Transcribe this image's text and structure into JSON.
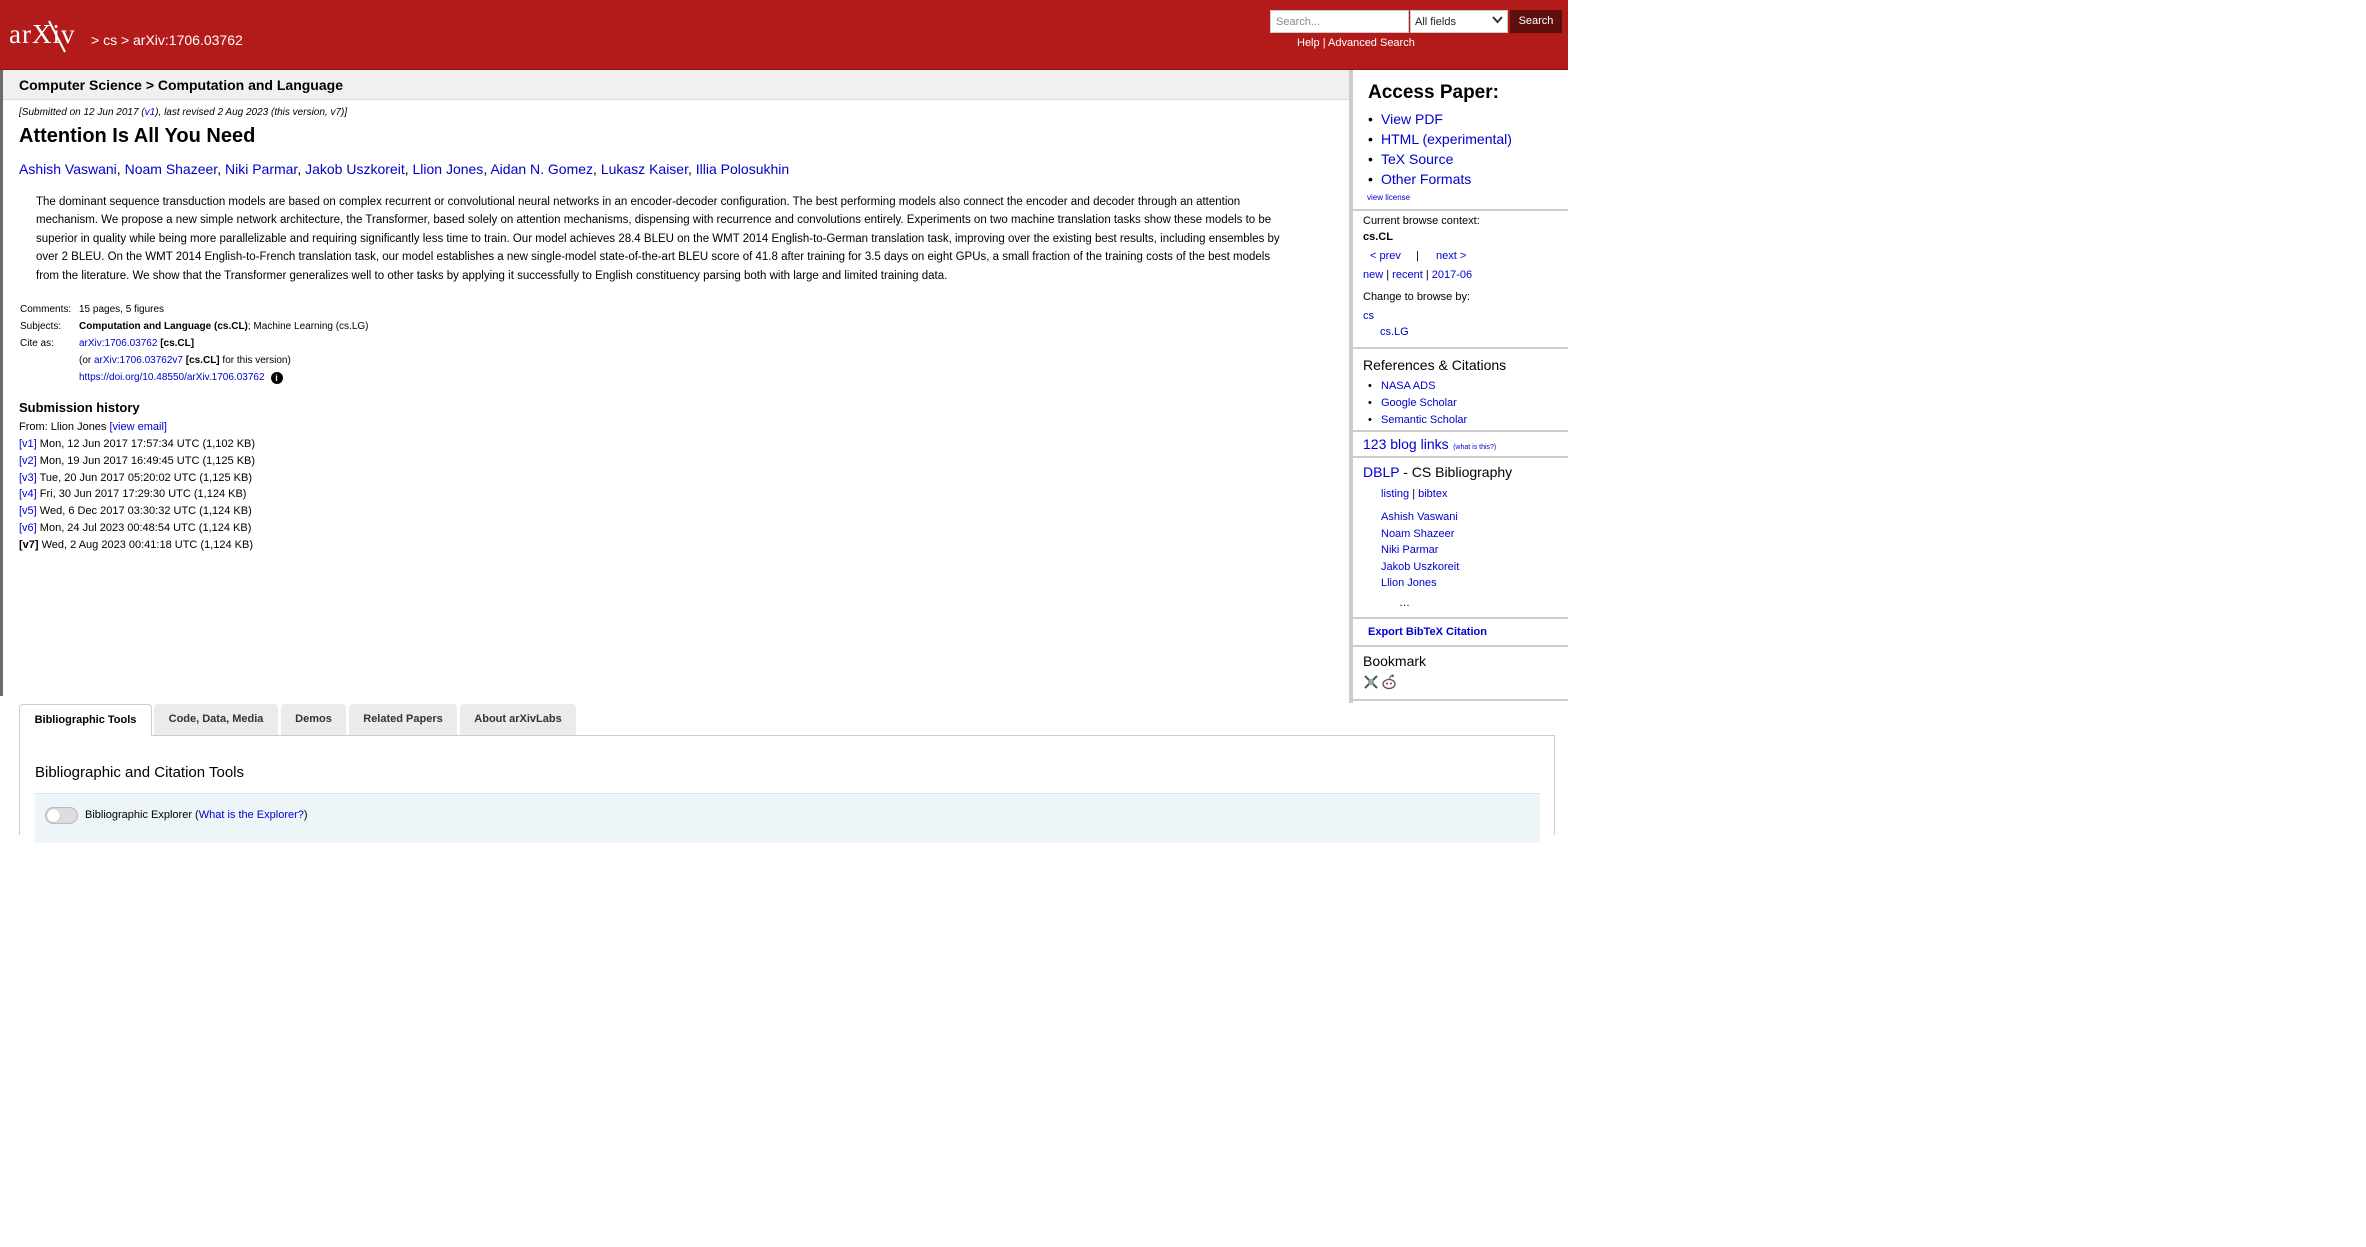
{
  "header": {
    "logo_text": "arXiv",
    "breadcrumb": "> cs > arXiv:1706.03762",
    "search": {
      "placeholder": "Search...",
      "field_value": "All fields",
      "button": "Search"
    },
    "help": "Help",
    "help_sep": "|",
    "advanced": "Advanced Search"
  },
  "catbar": "Computer Science > Computation and Language",
  "paper": {
    "dateline_pre": "[Submitted on 12 Jun 2017 (",
    "dateline_v1": "v1",
    "dateline_post": "), last revised 2 Aug 2023 (this version, v7)]",
    "title": "Attention Is All You Need",
    "authors": [
      "Ashish Vaswani",
      "Noam Shazeer",
      "Niki Parmar",
      "Jakob Uszkoreit",
      "Llion Jones",
      "Aidan N. Gomez",
      "Lukasz Kaiser",
      "Illia Polosukhin"
    ],
    "abstract_lines": [
      "The dominant sequence transduction models are based on complex recurrent or convolutional neural networks in an encoder-decoder configuration. The best performing models also connect the encoder and decoder through an attention",
      "mechanism. We propose a new simple network architecture, the Transformer, based solely on attention mechanisms, dispensing with recurrence and convolutions entirely. Experiments on two machine translation tasks show these models to be",
      "superior in quality while being more parallelizable and requiring significantly less time to train. Our model achieves 28.4 BLEU on the WMT 2014 English-to-German translation task, improving over the existing best results, including ensembles by",
      "over 2 BLEU. On the WMT 2014 English-to-French translation task, our model establishes a new single-model state-of-the-art BLEU score of 41.8 after training for 3.5 days on eight GPUs, a small fraction of the training costs of the best models",
      "from the literature. We show that the Transformer generalizes well to other tasks by applying it successfully to English constituency parsing both with large and limited training data."
    ]
  },
  "meta": {
    "comments_label": "Comments:",
    "comments": "15 pages, 5 figures",
    "subjects_label": "Subjects:",
    "subjects_primary": "Computation and Language (cs.CL)",
    "subjects_rest": "; Machine Learning (cs.LG)",
    "cite_label": "Cite as:",
    "cite_id": "arXiv:1706.03762",
    "cite_cat": "[cs.CL]",
    "cite2_pre": "(or ",
    "cite2_id": "arXiv:1706.03762v7",
    "cite2_cat": "[cs.CL]",
    "cite2_post": " for this version)",
    "doi": "https://doi.org/10.48550/arXiv.1706.03762"
  },
  "history": {
    "title": "Submission history",
    "from_pre": "From: Llion Jones ",
    "view_email": "[view email]",
    "versions": [
      {
        "v": "[v1]",
        "text": " Mon, 12 Jun 2017 17:57:34 UTC (1,102 KB)"
      },
      {
        "v": "[v2]",
        "text": " Mon, 19 Jun 2017 16:49:45 UTC (1,125 KB)"
      },
      {
        "v": "[v3]",
        "text": " Tue, 20 Jun 2017 05:20:02 UTC (1,125 KB)"
      },
      {
        "v": "[v4]",
        "text": " Fri, 30 Jun 2017 17:29:30 UTC (1,124 KB)"
      },
      {
        "v": "[v5]",
        "text": " Wed, 6 Dec 2017 03:30:32 UTC (1,124 KB)"
      },
      {
        "v": "[v6]",
        "text": " Mon, 24 Jul 2023 00:48:54 UTC (1,124 KB)"
      },
      {
        "v": "[v7]",
        "text": " Wed, 2 Aug 2023 00:41:18 UTC (1,124 KB)"
      }
    ]
  },
  "sidebar": {
    "access_title": "Access Paper:",
    "access_links": [
      "View PDF",
      "HTML (experimental)",
      "TeX Source",
      "Other Formats"
    ],
    "view_license": "view license",
    "browse_context_label": "Current browse context:",
    "browse_context": "cs.CL",
    "prev": "< prev",
    "pipe": "|",
    "next": "next >",
    "new": "new",
    "recent": "recent",
    "month": "2017-06",
    "change_browse": "Change to browse by:",
    "browse_cs": "cs",
    "browse_lg": "cs.LG",
    "refs_title": "References & Citations",
    "refs": [
      "NASA ADS",
      "Google Scholar",
      "Semantic Scholar"
    ],
    "blog_links": "123 blog links",
    "what_is_this": "(what is this?)",
    "dblp": "DBLP",
    "dblp_rest": " - CS Bibliography",
    "listing": "listing",
    "bibtex": "bibtex",
    "dblp_authors": [
      "Ashish Vaswani",
      "Noam Shazeer",
      "Niki Parmar",
      "Jakob Uszkoreit",
      "Llion Jones"
    ],
    "ellipsis": "…",
    "export": "Export BibTeX Citation",
    "bookmark": "Bookmark"
  },
  "tabs": [
    "Bibliographic Tools",
    "Code, Data, Media",
    "Demos",
    "Related Papers",
    "About arXivLabs"
  ],
  "panel": {
    "title": "Bibliographic and Citation Tools",
    "explorer_label": "Bibliographic Explorer (",
    "explorer_link": "What is the Explorer?",
    "explorer_close": ")"
  }
}
